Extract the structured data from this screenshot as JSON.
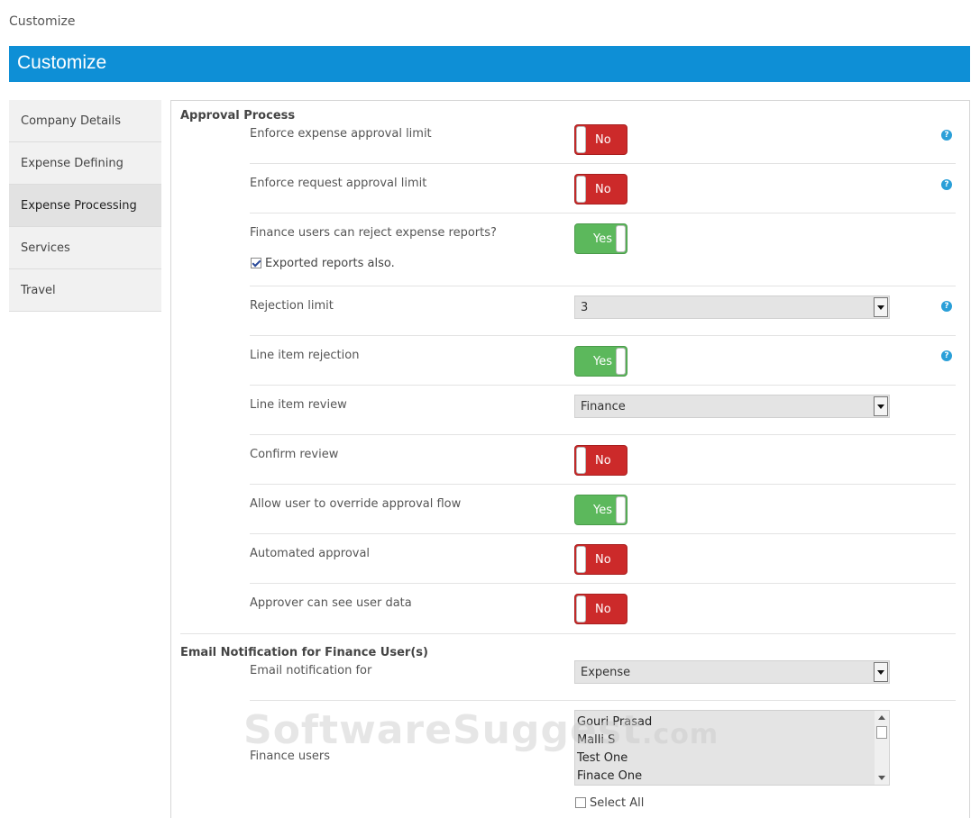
{
  "page_label": "Customize",
  "banner_title": "Customize",
  "colors": {
    "banner": "#0e8fd6",
    "toggle_no": "#cc2a2a",
    "toggle_yes": "#5cb85c",
    "help": "#2a9fd8"
  },
  "sidebar": {
    "items": [
      {
        "label": "Company Details"
      },
      {
        "label": "Expense Defining"
      },
      {
        "label": "Expense Processing",
        "active": true
      },
      {
        "label": "Services"
      },
      {
        "label": "Travel"
      }
    ]
  },
  "approval": {
    "title": "Approval Process",
    "enforce_expense": {
      "label": "Enforce expense approval limit",
      "value": "No",
      "help": "?"
    },
    "enforce_request": {
      "label": "Enforce request approval limit",
      "value": "No",
      "help": "?"
    },
    "finance_reject": {
      "label": "Finance users can reject expense reports?",
      "value": "Yes",
      "checkbox_label": "Exported reports also.",
      "checkbox_checked": true
    },
    "rejection_limit": {
      "label": "Rejection limit",
      "value": "3",
      "help": "?"
    },
    "line_item_rejection": {
      "label": "Line item rejection",
      "value": "Yes",
      "help": "?"
    },
    "line_item_review": {
      "label": "Line item review",
      "value": "Finance"
    },
    "confirm_review": {
      "label": "Confirm review",
      "value": "No"
    },
    "allow_override": {
      "label": "Allow user to override approval flow",
      "value": "Yes"
    },
    "automated_approval": {
      "label": "Automated approval",
      "value": "No"
    },
    "approver_see_data": {
      "label": "Approver can see user data",
      "value": "No"
    }
  },
  "email": {
    "title": "Email Notification for Finance User(s)",
    "notification_for": {
      "label": "Email notification for",
      "value": "Expense"
    },
    "finance_users": {
      "label": "Finance users",
      "options": [
        "Gouri Prasad",
        "Malli S",
        "Test One",
        "Finace One"
      ],
      "select_all_label": "Select All",
      "select_all_checked": false
    }
  },
  "watermark": {
    "main": "SoftwareSuggest",
    "suffix": ".com"
  }
}
